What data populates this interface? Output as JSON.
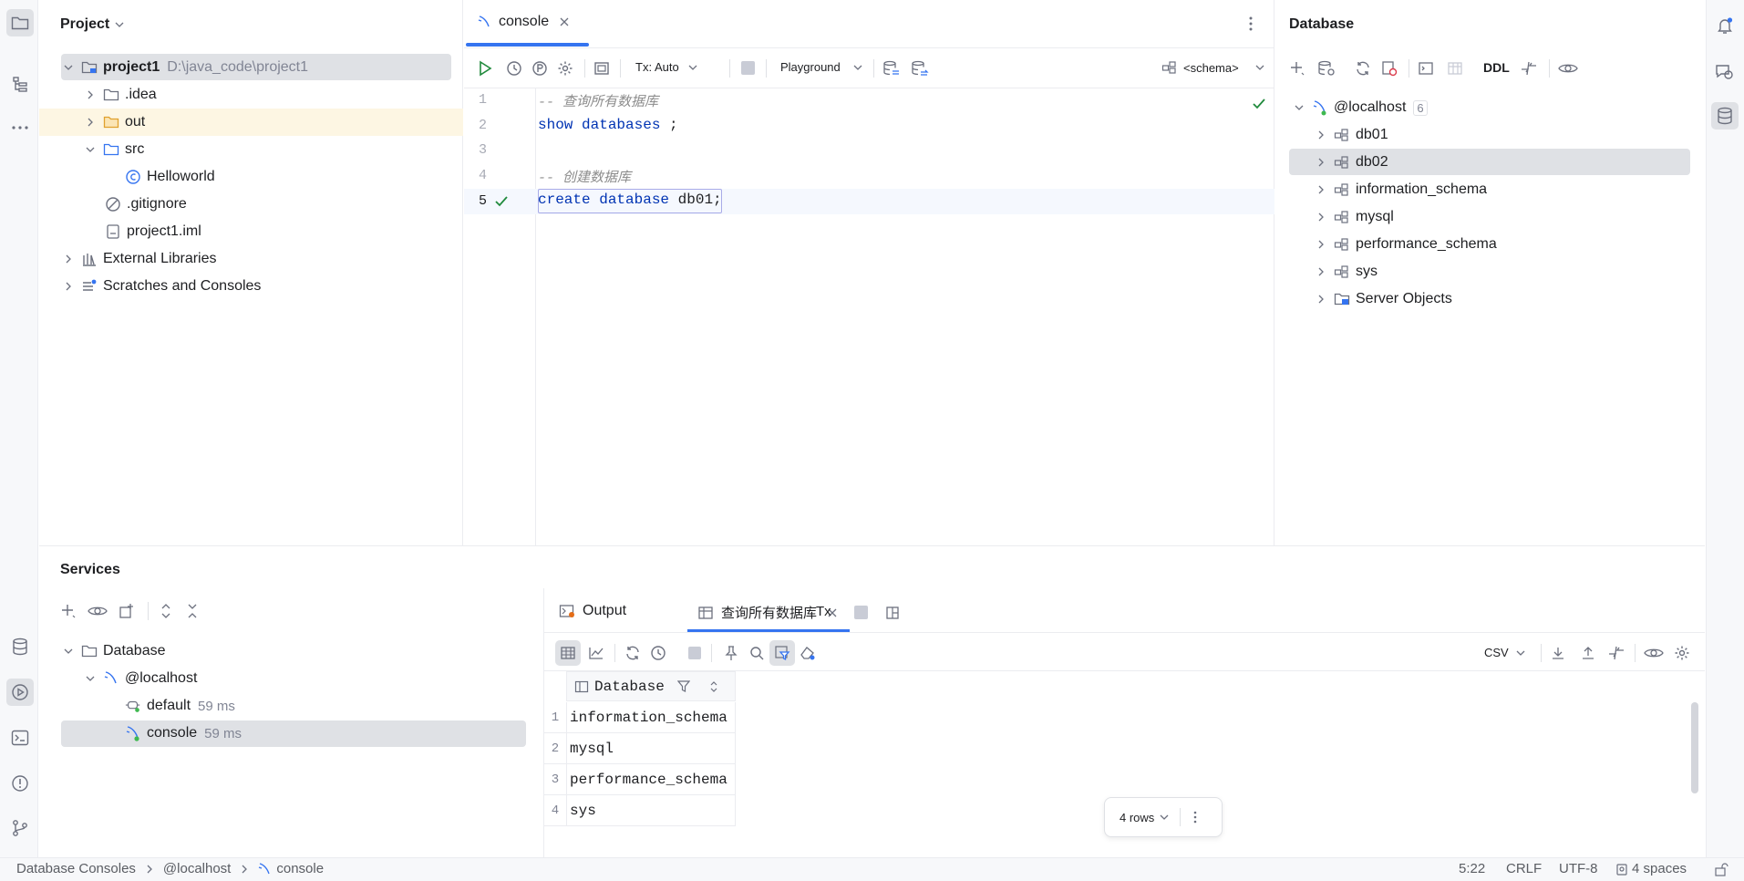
{
  "project_panel": {
    "title": "Project",
    "tree": [
      {
        "label": "project1",
        "path": "D:\\java_code\\project1"
      },
      {
        "label": ".idea"
      },
      {
        "label": "out"
      },
      {
        "label": "src"
      },
      {
        "label": "Helloworld"
      },
      {
        "label": ".gitignore"
      },
      {
        "label": "project1.iml"
      },
      {
        "label": "External Libraries"
      },
      {
        "label": "Scratches and Consoles"
      }
    ]
  },
  "editor": {
    "tab_label": "console",
    "toolbar": {
      "tx_label": "Tx: Auto",
      "playground_label": "Playground",
      "schema_label": "<schema>"
    },
    "line_numbers": [
      "1",
      "2",
      "3",
      "4",
      "5"
    ],
    "lines": {
      "l1": "-- 查询所有数据库",
      "l2_kw1": "show",
      "l2_kw2": "databases",
      "l2_rest": " ;",
      "l4": "-- 创建数据库",
      "l5_kw1": "create",
      "l5_kw2": "database",
      "l5_id": "db01",
      "l5_rest": ";"
    }
  },
  "database_panel": {
    "title": "Database",
    "ddl_label": "DDL",
    "root": {
      "label": "@localhost",
      "count": "6"
    },
    "items": [
      {
        "label": "db01"
      },
      {
        "label": "db02"
      },
      {
        "label": "information_schema"
      },
      {
        "label": "mysql"
      },
      {
        "label": "performance_schema"
      },
      {
        "label": "sys"
      },
      {
        "label": "Server Objects"
      }
    ]
  },
  "services": {
    "title": "Services",
    "tree": [
      {
        "label": "Database"
      },
      {
        "label": "@localhost"
      },
      {
        "label": "default",
        "time": "59 ms"
      },
      {
        "label": "console",
        "time": "59 ms"
      }
    ],
    "tabs": {
      "output": "Output",
      "result": "查询所有数据库",
      "tx": "Tx"
    },
    "csv_label": "CSV",
    "result_table": {
      "column": "Database",
      "rows": [
        {
          "n": "1",
          "v": "information_schema"
        },
        {
          "n": "2",
          "v": "mysql"
        },
        {
          "n": "3",
          "v": "performance_schema"
        },
        {
          "n": "4",
          "v": "sys"
        }
      ]
    },
    "rows_label": "4 rows"
  },
  "statusbar": {
    "crumbs": [
      "Database Consoles",
      "@localhost",
      "console"
    ],
    "position": "5:22",
    "line_sep": "CRLF",
    "encoding": "UTF-8",
    "indent": "4 spaces"
  },
  "colors": {
    "accent": "#3574f0",
    "keyword": "#0033b3",
    "comment": "#8c8c8c",
    "selection": "#dfe1e5",
    "folder": "#e0a12e"
  }
}
